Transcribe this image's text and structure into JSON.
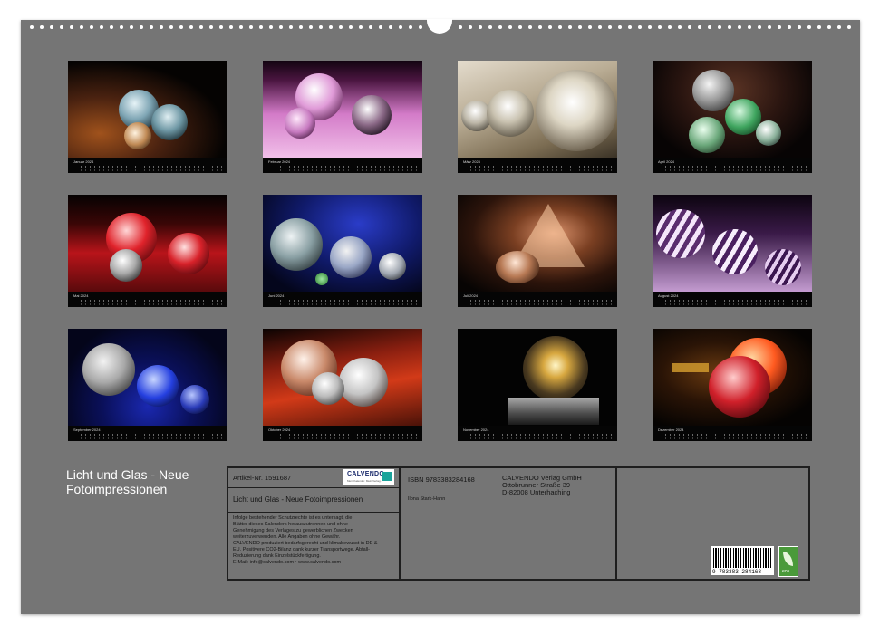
{
  "calendar": {
    "title": "Licht und Glas - Neue Fotoimpressionen",
    "months": [
      "Januar 2024",
      "Februar 2024",
      "März 2024",
      "April 2024",
      "Mai 2024",
      "Juni 2024",
      "Juli 2024",
      "August 2024",
      "September 2024",
      "Oktober 2024",
      "November 2024",
      "Dezember 2024"
    ]
  },
  "info": {
    "article": "Artikel-Nr. 1591687",
    "product_title": "Licht und Glas - Neue Fotoimpressionen",
    "legal_lines": [
      "Infolge bestehender Schutzrechte ist es untersagt, die",
      "Blätter dieses Kalenders herauszutrennen und ohne",
      "Genehmigung des Verlages zu gewerblichen Zwecken",
      "weiterzuverwenden. Alle Angaben ohne Gewähr.",
      "CALVENDO produziert bedarfsgerecht und klimabewusst in DE &",
      "EU. Positivere CO2-Bilanz dank kurzer Transportwege. Abfall-",
      "Reduzierung dank Einzelstückfertigung.",
      "E-Mail: info@calvendo.com • www.calvendo.com"
    ],
    "isbn": "ISBN 9783383284168",
    "author": "Ilona Stark-Hahn",
    "publisher": [
      "CALVENDO Verlag GmbH",
      "Ottobrunner Straße 39",
      "D-82008 Unterhaching"
    ],
    "logo_text": "CALVENDO",
    "logo_sub": "Mein Kalender. Mein Verlag.",
    "barcode_number": "9 783383 284168",
    "eco_label": "eco"
  },
  "colors": {
    "background": "#757575",
    "panel_border": "#1e1e1e",
    "title_text": "#ffffff"
  }
}
